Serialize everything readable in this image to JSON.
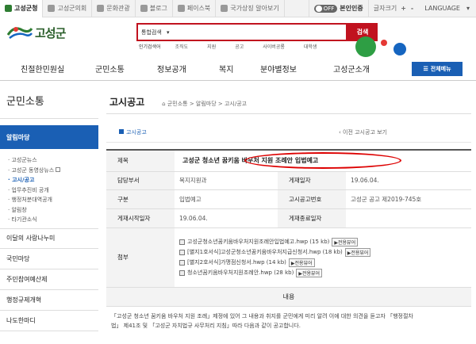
{
  "topbar": {
    "tabs": [
      {
        "label": "고성군청",
        "color": "#2e7d32"
      },
      {
        "label": "고성군의회",
        "color": "#8d8d8d"
      },
      {
        "label": "문화관광",
        "color": "#8d8d8d"
      },
      {
        "label": "블로그",
        "color": "#8d8d8d"
      },
      {
        "label": "페이스북",
        "color": "#8d8d8d"
      },
      {
        "label": "국가상징 알아보기",
        "color": "#8d8d8d"
      }
    ],
    "toggle_state": "OFF",
    "toggle_label": "본인인증",
    "font_size_label": "글자크기",
    "plus": "+",
    "minus": "-",
    "language": "LANGUAGE",
    "chevron": "▾"
  },
  "logo": {
    "text": "고성군"
  },
  "search": {
    "scope": "통합검색",
    "scope_arrow": "▾",
    "value": "",
    "button": "검색",
    "keywords_label": "인기검색어",
    "keywords": [
      "조직도",
      "지원",
      "공고",
      "사이버공룡",
      "대학생"
    ]
  },
  "nav": {
    "items": [
      "친절한민원실",
      "군민소통",
      "정보공개",
      "복지",
      "분야별정보",
      "고성군소개"
    ],
    "all_menu": "전체메뉴"
  },
  "sidebar": {
    "title": "군민소통",
    "selected": "알림마당",
    "sub_items": [
      "고성군뉴스",
      "고성군 동영상뉴스",
      "고시/공고",
      "업무추진비 공개",
      "행정처분대역공개",
      "알림창",
      "타기관소식"
    ],
    "items": [
      "이달의 사랑나누미",
      "국민마당",
      "주민참여예산제",
      "행정규제개혁",
      "나도한마디"
    ]
  },
  "content": {
    "title": "고시공고",
    "breadcrumb": "군민소통 > 알림마당 > 고시/공고",
    "back_link": "고시공고",
    "prev_link": "이전 고시공고 보기",
    "rows": {
      "subject_label": "제목",
      "subject": "고성군 청소년 꿈키움 바우처 지원 조례안 입법예고",
      "dept_label": "담당부서",
      "dept": "복지지원과",
      "date_label": "게재일자",
      "date": "19.06.04.",
      "type_label": "구분",
      "type": "입법예고",
      "notice_no_label": "고시공고번호",
      "notice_no": "고성군 공고 제2019-745호",
      "start_label": "게재시작일자",
      "start": "19.06.04.",
      "end_label": "게재종료일자",
      "end": "",
      "attach_label": "첨부"
    },
    "attachments": [
      {
        "name": "고성군청소년꿈키움바우처지원조례안입법예고.hwp (15 kb)",
        "preview": "전용뷰어"
      },
      {
        "name": "[별지1호서식]고성군청소년꿈키움바우처지급신청서.hwp (18 kb)",
        "preview": "전용뷰어"
      },
      {
        "name": "[별지2호서식]가맹점신청서.hwp (14 kb)",
        "preview": "전용뷰어"
      },
      {
        "name": "청소년꿈키움바우처지원조례안.hwp (28 kb)",
        "preview": "전용뷰어"
      }
    ],
    "content_label": "내용",
    "body_line1": "「고성군 청소년 꿈키움 바우처 지원 조례」제정에 있어 그 내용과 취지를 군민에게 미리 알려 이에 대한 의견을 듣고자 「행정절차",
    "body_line2": "법」 제41조 및 「고성군 자치법규 사무처리 지침」따라 다음과 같이 공고합니다."
  },
  "colors": {
    "accent": "#1a5fb4",
    "search_red": "#c1121f",
    "annotation_red": "#dd0000",
    "logo_green": "#2b5f2b"
  }
}
